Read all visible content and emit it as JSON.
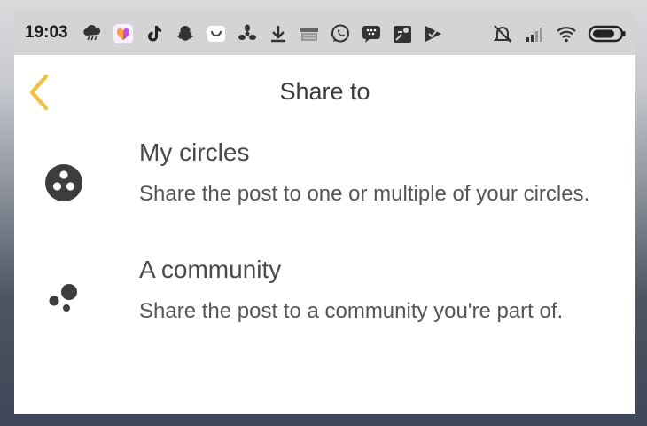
{
  "status_bar": {
    "time": "19:03",
    "left_icons": [
      "weather-storm-icon",
      "photo-app-icon",
      "tiktok-icon",
      "snapchat-icon",
      "shopping-bag-icon",
      "fan-app-icon",
      "download-icon",
      "amazon-icon",
      "whatsapp-icon",
      "blackberry-icon",
      "maps-icon",
      "checkmark-app-icon"
    ],
    "right_icons": [
      "bell-muted-icon",
      "signal-icon",
      "wifi-icon",
      "battery-icon"
    ]
  },
  "header": {
    "title": "Share to",
    "back_icon": "chevron-left-icon",
    "accent_color": "#f0c24b"
  },
  "options": [
    {
      "title": "My circles",
      "description": "Share the post to one or multiple of your circles.",
      "icon": "circles-icon"
    },
    {
      "title": "A community",
      "description": "Share the post to a community you're part of.",
      "icon": "community-icon"
    }
  ],
  "colors": {
    "icon_color": "#3d3d3d",
    "text_color": "#4a4a4a",
    "status_bar_bg": "#d4d4d4"
  }
}
